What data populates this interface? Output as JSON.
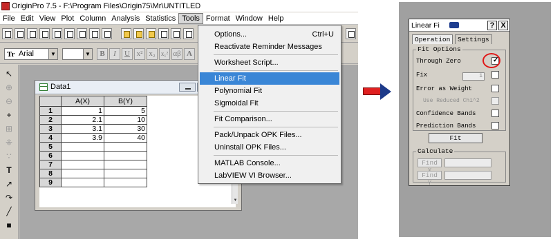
{
  "app": {
    "window_title": "OriginPro 7.5 - F:\\Program Files\\Origin75\\Mr\\UNTITLED",
    "menus": [
      "File",
      "Edit",
      "View",
      "Plot",
      "Column",
      "Analysis",
      "Statistics",
      "Tools",
      "Format",
      "Window",
      "Help"
    ],
    "active_menu": "Tools",
    "font_name": "Arial",
    "format_buttons": [
      "B",
      "I",
      "U",
      "x²",
      "x₂",
      "x₁²",
      "αβ",
      "A"
    ]
  },
  "tools_menu": {
    "items": [
      {
        "label": "Options...",
        "shortcut": "Ctrl+U"
      },
      {
        "label": "Reactivate Reminder Messages",
        "shortcut": ""
      },
      {
        "label": "Worksheet Script...",
        "shortcut": ""
      },
      {
        "label": "Linear Fit",
        "shortcut": "",
        "highlighted": true
      },
      {
        "label": "Polynomial Fit",
        "shortcut": ""
      },
      {
        "label": "Sigmoidal Fit",
        "shortcut": ""
      },
      {
        "label": "Fit Comparison...",
        "shortcut": ""
      },
      {
        "label": "Pack/Unpack OPK Files...",
        "shortcut": ""
      },
      {
        "label": "Uninstall OPK Files...",
        "shortcut": ""
      },
      {
        "label": "MATLAB Console...",
        "shortcut": ""
      },
      {
        "label": "LabVIEW VI Browser...",
        "shortcut": ""
      }
    ]
  },
  "worksheet": {
    "title": "Data1",
    "columns": [
      "A(X)",
      "B(Y)"
    ],
    "rows": [
      {
        "n": "1",
        "a": "1",
        "b": "5"
      },
      {
        "n": "2",
        "a": "2.1",
        "b": "10"
      },
      {
        "n": "3",
        "a": "3.1",
        "b": "30"
      },
      {
        "n": "4",
        "a": "3.9",
        "b": "40"
      },
      {
        "n": "5",
        "a": "",
        "b": ""
      },
      {
        "n": "6",
        "a": "",
        "b": ""
      },
      {
        "n": "7",
        "a": "",
        "b": ""
      },
      {
        "n": "8",
        "a": "",
        "b": ""
      },
      {
        "n": "9",
        "a": "",
        "b": ""
      }
    ]
  },
  "linear_fit_dialog": {
    "title": "Linear Fi",
    "help_label": "?",
    "close_label": "X",
    "tabs": [
      "Operation",
      "Settings"
    ],
    "fit_options_label": "Fit Options",
    "options": [
      {
        "label": "Through Zero",
        "checked": true,
        "enabled": true
      },
      {
        "label": "Fix",
        "checked": false,
        "enabled": true,
        "value": "1"
      },
      {
        "label": "Error as Weight",
        "checked": false,
        "enabled": true
      },
      {
        "label": "Use Reduced Chi^2",
        "checked": false,
        "enabled": false
      },
      {
        "label": "Confidence Bands",
        "checked": false,
        "enabled": true
      },
      {
        "label": "Prediction Bands",
        "checked": false,
        "enabled": true
      }
    ],
    "fit_button": "Fit",
    "calculate_label": "Calculate",
    "find_x_button": "Find X",
    "find_y_button": "Find Y"
  },
  "colors": {
    "menu_highlight": "#3a86d6",
    "arrow_shaft": "#e02020",
    "arrow_head": "#1d3a8a",
    "annotation_circle": "#e01818"
  }
}
